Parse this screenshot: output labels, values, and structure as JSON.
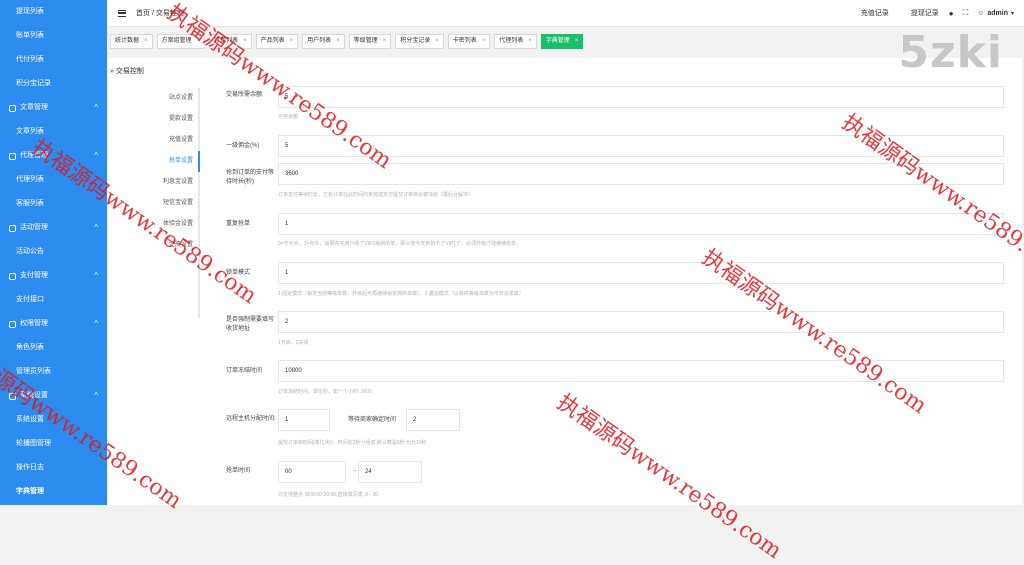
{
  "sidebar": {
    "items": [
      {
        "type": "item",
        "label": "提现列表"
      },
      {
        "type": "item",
        "label": "账单列表"
      },
      {
        "type": "item",
        "label": "代付列表"
      },
      {
        "type": "item",
        "label": "积分宝记录"
      },
      {
        "type": "group",
        "label": "文章管理",
        "arrow": "^"
      },
      {
        "type": "item",
        "label": "文章列表"
      },
      {
        "type": "group",
        "label": "代理管理",
        "arrow": "^"
      },
      {
        "type": "item",
        "label": "代理列表"
      },
      {
        "type": "item",
        "label": "客服列表"
      },
      {
        "type": "group",
        "label": "活动管理",
        "arrow": "^"
      },
      {
        "type": "item",
        "label": "活动公告"
      },
      {
        "type": "group",
        "label": "支付管理",
        "arrow": "^"
      },
      {
        "type": "item",
        "label": "支付接口"
      },
      {
        "type": "group",
        "label": "权限管理",
        "arrow": "^"
      },
      {
        "type": "item",
        "label": "角色列表"
      },
      {
        "type": "item",
        "label": "管理员列表"
      },
      {
        "type": "group",
        "label": "系统设置",
        "arrow": "^"
      },
      {
        "type": "item",
        "label": "系统设置"
      },
      {
        "type": "item",
        "label": "轮播图管理"
      },
      {
        "type": "item",
        "label": "操作日志"
      },
      {
        "type": "item",
        "label": "字典管理",
        "active": true
      }
    ]
  },
  "header": {
    "menu_icon": "hamburger-icon",
    "breadcrumb": "首页 / 交易控制",
    "recharge_link": "充值记录",
    "withdraw_link": "提现记录",
    "bell_icon": "bell-icon",
    "fullscreen_icon": "fullscreen-icon",
    "user_icon": "user-icon",
    "username": "admin",
    "caret": "▾"
  },
  "tabs": [
    {
      "label": "统计数据",
      "close": "×"
    },
    {
      "label": "方案组管理",
      "close": "×"
    },
    {
      "label": "订单列表",
      "close": "×"
    },
    {
      "label": "产品列表",
      "close": "×"
    },
    {
      "label": "用户列表",
      "close": "×"
    },
    {
      "label": "等级管理",
      "close": "×"
    },
    {
      "label": "积分宝记录",
      "close": "×"
    },
    {
      "label": "卡密列表",
      "close": "×"
    },
    {
      "label": "代理列表",
      "close": "×"
    },
    {
      "label": "字典管理",
      "close": "×",
      "active": true
    }
  ],
  "panel": {
    "title": "» 交易控制"
  },
  "subnav": [
    {
      "label": "站点设置"
    },
    {
      "label": "提款设置"
    },
    {
      "label": "充值设置"
    },
    {
      "label": "抢单设置",
      "active": true
    },
    {
      "label": "利息宝设置"
    },
    {
      "label": "短信宝设置"
    },
    {
      "label": "体验金设置"
    },
    {
      "label": "注册设置"
    }
  ],
  "form": {
    "min_balance": {
      "label": "交易所需余额",
      "value": "5",
      "help": "可用余额"
    },
    "level1_commission": {
      "label": "一级佣金(%)",
      "value": "5"
    },
    "pay_wait": {
      "label": "抢到订单的支付等待时长(秒)",
      "value": "3600",
      "help": "订单支付等待时长，已抢订单在此时间内未完成支付提交订单将会被冻结（需后台解冻）"
    },
    "repeat_order": {
      "label": "重复抢单",
      "value": "1",
      "help": "0=不允许，1=允许，如果购买用户购了VIP1级别的单，那么他今天就抢不了VIP1了，必须升级才能继续抢单。"
    },
    "order_mode": {
      "label": "锁单模式",
      "value": "1",
      "help": "1:固定模式（锁定当前等级单数，升级后可再继续锁定高的单数），2:叠加模式（以最终等级单数为今日总单数）"
    },
    "force_address": {
      "label": "是否强制需要填写收货地址",
      "value": "2",
      "help": "1开启，2关闭"
    },
    "freeze_time": {
      "label": "订单冻结时间",
      "value": "10800",
      "help": "订单冻结时间，单位秒，如一个小时: 3600"
    },
    "distribute": {
      "label": "远程主机分配时间:",
      "value1": "1",
      "mid_label": "等待商家确定时间",
      "value2": "2",
      "help": "提交订单到时间(单位/秒)，时间在2秒分组成;默认算是5秒;也允10秒"
    },
    "grab_time": {
      "label": "抢单时间",
      "from": "00",
      "sep": "-",
      "to": "24",
      "help": "只支持整点 如08:00-20:00,直接填写成: 8 - 20"
    }
  },
  "watermark": {
    "text1": "执福源码",
    "text2": "www.re589.com",
    "color": "#e0181c"
  },
  "logo": "5zki",
  "colors": {
    "sidebar_bg": "#2d8cf0",
    "active_tab": "#19be6b",
    "accent": "#2d8cf0"
  }
}
